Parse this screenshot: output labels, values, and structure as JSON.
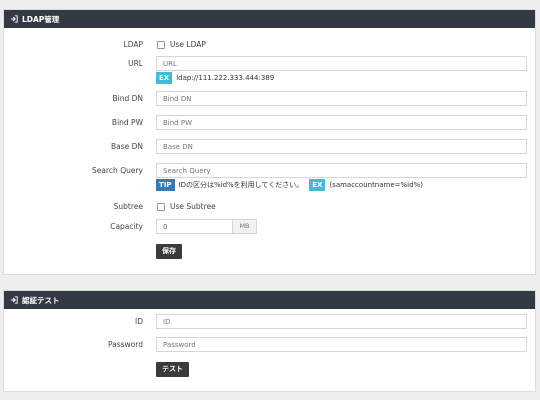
{
  "ldap_panel": {
    "title": "LDAP管理",
    "ldap": {
      "label": "LDAP",
      "checkbox_label": "Use LDAP",
      "checked": false
    },
    "url": {
      "label": "URL",
      "placeholder": "URL",
      "example_tag": "EX",
      "example_text": "ldap://111.222.333.444:389"
    },
    "bind_dn": {
      "label": "Bind DN",
      "placeholder": "Bind DN"
    },
    "bind_pw": {
      "label": "Bind PW",
      "placeholder": "Bind PW"
    },
    "base_dn": {
      "label": "Base DN",
      "placeholder": "Base DN"
    },
    "search_query": {
      "label": "Search Query",
      "placeholder": "Search Query",
      "tip_tag": "TIP",
      "tip_text": "IDの区分は%id%を利用してください。",
      "example_tag": "EX",
      "example_text": "(samaccountname=%id%)"
    },
    "subtree": {
      "label": "Subtree",
      "checkbox_label": "Use Subtree",
      "checked": false
    },
    "capacity": {
      "label": "Capacity",
      "value": "0",
      "unit": "MB"
    },
    "save_button": "保存"
  },
  "auth_panel": {
    "title": "認証テスト",
    "id": {
      "label": "ID",
      "placeholder": "ID"
    },
    "password": {
      "label": "Password",
      "placeholder": "Password"
    },
    "test_button": "テスト"
  },
  "colors": {
    "header_bg": "#343a44",
    "example_tag": "#46b8da",
    "tip_tag": "#337ab7",
    "button_bg": "#3a3a3a"
  }
}
